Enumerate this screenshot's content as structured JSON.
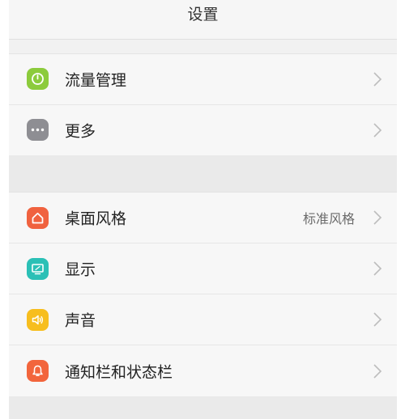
{
  "header": {
    "title": "设置"
  },
  "groups": [
    {
      "items": [
        {
          "label": "流量管理",
          "icon": "data-usage-icon",
          "icon_color": "#8CCB3C"
        },
        {
          "label": "更多",
          "icon": "more-icon",
          "icon_color": "#8E8E93"
        }
      ]
    },
    {
      "items": [
        {
          "label": "桌面风格",
          "value": "标准风格",
          "icon": "home-icon",
          "icon_color": "#F0623F"
        },
        {
          "label": "显示",
          "icon": "display-icon",
          "icon_color": "#2BC0B6"
        },
        {
          "label": "声音",
          "icon": "speaker-icon",
          "icon_color": "#F7BE1E"
        },
        {
          "label": "通知栏和状态栏",
          "icon": "bell-icon",
          "icon_color": "#F2653C"
        }
      ]
    }
  ]
}
